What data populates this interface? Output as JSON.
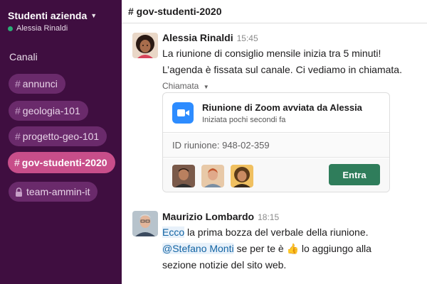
{
  "workspace": {
    "name": "Studenti azienda",
    "user": "Alessia Rinaldi"
  },
  "sidebar": {
    "section_title": "Canali",
    "channels": [
      {
        "prefix": "#",
        "label": "annunci"
      },
      {
        "prefix": "#",
        "label": "geologia-101"
      },
      {
        "prefix": "#",
        "label": "progetto-geo-101"
      },
      {
        "prefix": "#",
        "label": "gov-studenti-2020"
      },
      {
        "prefix": "lock",
        "label": "team-ammin-it"
      }
    ],
    "active_index": 3
  },
  "header": {
    "channel": "# gov-studenti-2020"
  },
  "messages": [
    {
      "author": "Alessia Rinaldi",
      "time": "15:45",
      "line1": "La riunione di consiglio mensile inizia tra 5 minuti!",
      "line2": "L’agenda è fissata sul canale. Ci vediamo in chiamata."
    },
    {
      "author": "Maurizio Lombardo",
      "time": "18:15",
      "link_text": "Ecco",
      "line1_rest": " la prima bozza del verbale della riunione.",
      "mention": "@Stefano Monti",
      "line2_mid": " se per te è ",
      "emoji": "👍",
      "line2_rest": " lo aggiungo alla",
      "line3": "sezione notizie del sito web."
    }
  ],
  "call": {
    "label": "Chiamata",
    "title": "Riunione di Zoom avviata da Alessia",
    "subtitle": "Iniziata pochi secondi fa",
    "meeting_id": "ID riunione: 948-02-359",
    "join_label": "Entra"
  },
  "colors": {
    "sidebar_bg": "#3f0e40",
    "active_channel": "#c84e8a",
    "join_button": "#2f7d5b",
    "zoom_blue": "#2d8cff"
  }
}
